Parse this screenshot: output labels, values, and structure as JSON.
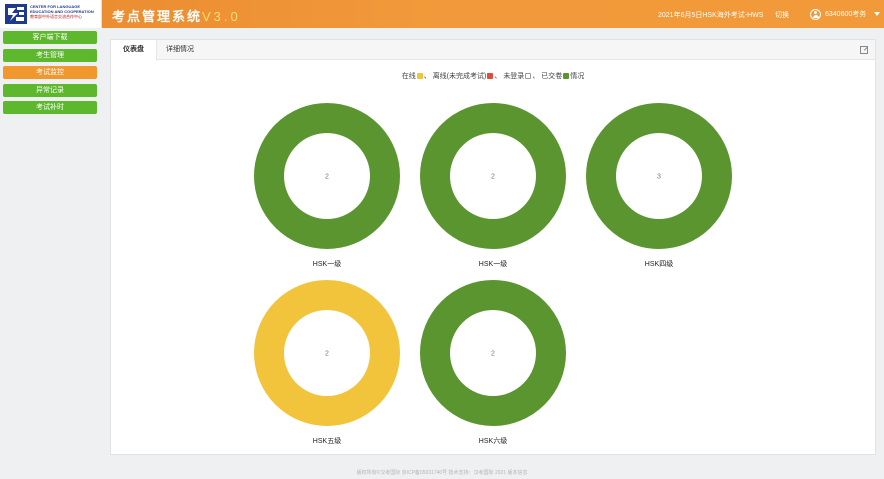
{
  "header": {
    "logo_en_1": "CENTER FOR LANGUAGE",
    "logo_en_2": "EDUCATION AND COOPERATION",
    "logo_cn": "教育部中外语言交流合作中心",
    "app_title": "考点管理系统",
    "app_version": "V3.0",
    "exam_name": "2021年6月5日HSK海外考试-HWS",
    "switch_label": "切换",
    "username": "6340600考务"
  },
  "sidebar": {
    "items": [
      {
        "label": "客户端下载",
        "color": "#5db82d",
        "active": false
      },
      {
        "label": "考生管理",
        "color": "#5db82d",
        "active": false
      },
      {
        "label": "考试监控",
        "color": "#f0972e",
        "active": true
      },
      {
        "label": "异常记录",
        "color": "#5db82d",
        "active": false
      },
      {
        "label": "考试补时",
        "color": "#5db82d",
        "active": false
      }
    ]
  },
  "tabs": [
    {
      "label": "仪表盘",
      "active": true
    },
    {
      "label": "详细情况",
      "active": false
    }
  ],
  "legend": {
    "items": [
      {
        "label": "在线",
        "color": "#f2c43c",
        "suffix": "、"
      },
      {
        "label": "离线(未完成考试)",
        "color": "#e04b3a",
        "suffix": "、"
      },
      {
        "label": "未登录",
        "color": "#ffffff",
        "suffix": "、"
      },
      {
        "label": "已交卷",
        "color": "#5a9530",
        "suffix": "情况"
      }
    ]
  },
  "chart_data": {
    "type": "pie",
    "charts": [
      {
        "label": "HSK一级",
        "value": 2,
        "color": "#5a9530"
      },
      {
        "label": "HSK一级",
        "value": 2,
        "color": "#5a9530"
      },
      {
        "label": "HSK四级",
        "value": 3,
        "color": "#5a9530"
      },
      {
        "label": "HSK五级",
        "value": 2,
        "color": "#f2c43c"
      },
      {
        "label": "HSK六级",
        "value": 2,
        "color": "#5a9530"
      }
    ]
  },
  "footer": {
    "text": "版权所有©汉考国际 京ICP备05031740号 技术支持：汉考国际 2021 版本信息"
  }
}
